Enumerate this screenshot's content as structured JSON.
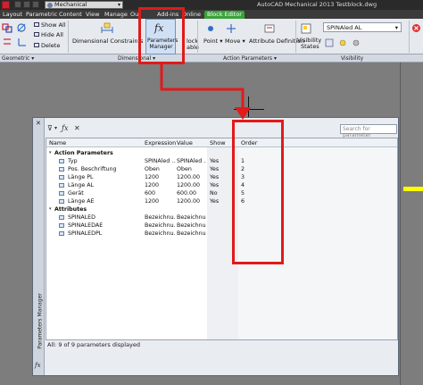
{
  "app": {
    "workspace": "Mechanical",
    "title": "AutoCAD Mechanical 2013   Testblock.dwg"
  },
  "ribbon_tabs": [
    "Layout",
    "Parametric",
    "Content",
    "View",
    "Manage",
    "Out",
    "Add-ins",
    "Online",
    "Block Editor"
  ],
  "ribbon": {
    "show_all": "Show All",
    "hide_all": "Hide All",
    "delete": "Delete",
    "dim_constraints": "Dimensional Constraints Flyout",
    "params_manager_line1": "Parameters",
    "params_manager_line2": "Manager",
    "block_frag_1": "lock",
    "block_frag_2": "able",
    "point": "Point",
    "move": "Move",
    "attribute_definition": "Attribute Definition",
    "visibility_states_1": "Visibility",
    "visibility_states_2": "States",
    "visibility_dropdown": "SPINAled AL"
  },
  "panel_titles": {
    "geometric": "Geometric",
    "dimensional": "Dimensional",
    "action_parameters": "Action Parameters",
    "visibility": "Visibility"
  },
  "palette": {
    "vertical_title": "Parameters Manager",
    "search_placeholder": "Search for parameter",
    "columns": {
      "name": "Name",
      "expression": "Expression",
      "value": "Value",
      "show": "Show",
      "order": "Order"
    },
    "categories": {
      "action": "Action Parameters",
      "attributes": "Attributes"
    },
    "rows": [
      {
        "name": "Typ",
        "expression": "SPINAled ...",
        "value": "SPINAled ...",
        "show": "Yes",
        "order": "1"
      },
      {
        "name": "Pos. Beschriftung",
        "expression": "Oben",
        "value": "Oben",
        "show": "Yes",
        "order": "2"
      },
      {
        "name": "Länge PL",
        "expression": "1200",
        "value": "1200.00",
        "show": "Yes",
        "order": "3"
      },
      {
        "name": "Länge AL",
        "expression": "1200",
        "value": "1200.00",
        "show": "Yes",
        "order": "4"
      },
      {
        "name": "Gerät",
        "expression": "600",
        "value": "600.00",
        "show": "No",
        "order": "5"
      },
      {
        "name": "Länge AE",
        "expression": "1200",
        "value": "1200.00",
        "show": "Yes",
        "order": "6"
      }
    ],
    "attributes": [
      {
        "name": "SPINALED",
        "expression": "Bezeichnu...",
        "value": "Bezeichnu..."
      },
      {
        "name": "SPINALEDAE",
        "expression": "Bezeichnu...",
        "value": "Bezeichnu..."
      },
      {
        "name": "SPINALEDPL",
        "expression": "Bezeichnu...",
        "value": "Bezeichnu..."
      }
    ],
    "status": "All: 9 of 9 parameters displayed"
  },
  "colors": {
    "annotation_red": "#e11a1a",
    "block_editor_tab": "#3aa23a",
    "drawing_bg": "#7d7d7d"
  }
}
